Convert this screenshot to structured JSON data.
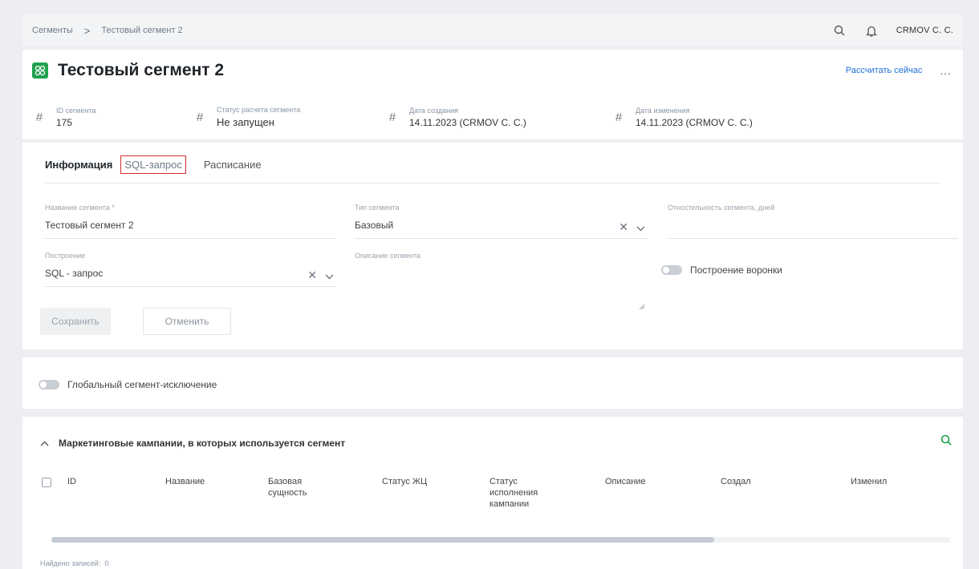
{
  "breadcrumb": {
    "items": [
      "Сегменты",
      "Тестовый сегмент 2"
    ],
    "separator": ">"
  },
  "topbar": {
    "user": "CRMOV C. C.",
    "icons": [
      "search-icon",
      "bell-icon"
    ]
  },
  "header": {
    "title": "Тестовый сегмент 2",
    "calc_now": "Рассчитать сейчас",
    "more": "...",
    "meta": [
      {
        "label": "ID сегмента",
        "value": "175"
      },
      {
        "label": "Статус расчета сегмента",
        "value": "Не запущен"
      },
      {
        "label": "Дата создания",
        "value": "14.11.2023 (CRMOV C. C.)"
      },
      {
        "label": "Дата изменения",
        "value": "14.11.2023 (CRMOV C. C.)"
      }
    ]
  },
  "tabs": [
    "Информация",
    "SQL-запрос",
    "Расписание"
  ],
  "form": {
    "name_label": "Название сегмента *",
    "name_value": "Тестовый сегмент 2",
    "type_label": "Тип сегмента",
    "type_value": "Базовый",
    "relevance_label": "Отностельность сегмента, дней",
    "build_label": "Построение",
    "build_value": "SQL - запрос",
    "desc_label": "Описание сегмента",
    "funnel_label": "Построение воронки",
    "save": "Сохранить",
    "cancel": "Отменить"
  },
  "global_exclusion": "Глобальный сегмент-исключение",
  "campaigns": {
    "title": "Маркетинговые кампании, в которых используется сегмент",
    "columns": [
      [
        "ID"
      ],
      [
        "Название"
      ],
      [
        "Базовая",
        "сущность"
      ],
      [
        "Статус ЖЦ"
      ],
      [
        "Статус",
        "исполнения",
        "кампании"
      ],
      [
        "Описание"
      ],
      [
        "Создал"
      ],
      [
        "Изменил"
      ]
    ],
    "found_label": "Найдено записей:",
    "found_count": "0"
  },
  "colors": {
    "accent": "#1e6fd9",
    "segment_icon": "#1fa14e",
    "highlight_box": "#d42b2b"
  }
}
